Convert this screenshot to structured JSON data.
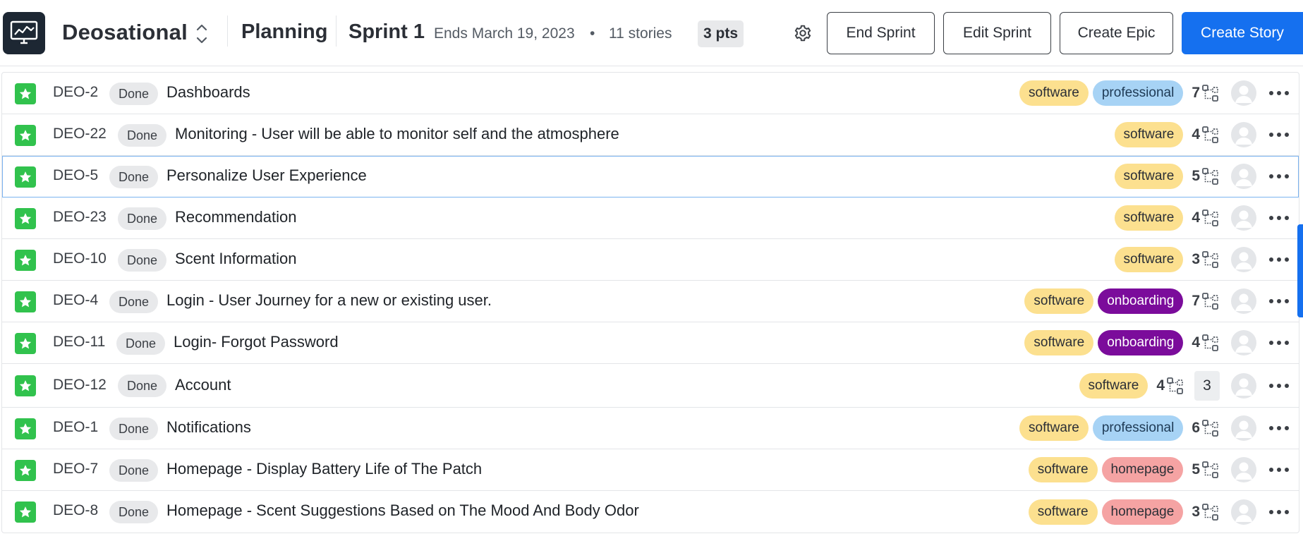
{
  "header": {
    "project_name": "Deosational",
    "page": "Planning",
    "sprint_name": "Sprint 1",
    "sprint_ends": "Ends March 19, 2023",
    "separator": "•",
    "stories_count": "11 stories",
    "points": "3 pts",
    "buttons": {
      "end_sprint": "End Sprint",
      "edit_sprint": "Edit Sprint",
      "create_epic": "Create Epic",
      "create_story": "Create Story"
    },
    "colors": {
      "primary": "#1570ef",
      "logo_bg": "#1d2733"
    },
    "icons": [
      "monitor-chart-icon",
      "chevron-up-down-icon",
      "gear-icon"
    ]
  },
  "stories": [
    {
      "key": "DEO-2",
      "status": "Done",
      "title": "Dashboards",
      "tags": [
        "software",
        "professional"
      ],
      "subtasks": "7",
      "comments": ""
    },
    {
      "key": "DEO-22",
      "status": "Done",
      "title": "Monitoring - User will be able to monitor self and the atmosphere",
      "tags": [
        "software"
      ],
      "subtasks": "4",
      "comments": ""
    },
    {
      "key": "DEO-5",
      "status": "Done",
      "title": "Personalize User Experience",
      "tags": [
        "software"
      ],
      "subtasks": "5",
      "comments": ""
    },
    {
      "key": "DEO-23",
      "status": "Done",
      "title": "Recommendation",
      "tags": [
        "software"
      ],
      "subtasks": "4",
      "comments": ""
    },
    {
      "key": "DEO-10",
      "status": "Done",
      "title": "Scent Information",
      "tags": [
        "software"
      ],
      "subtasks": "3",
      "comments": ""
    },
    {
      "key": "DEO-4",
      "status": "Done",
      "title": "Login - User Journey for a new or existing user.",
      "tags": [
        "software",
        "onboarding"
      ],
      "subtasks": "7",
      "comments": ""
    },
    {
      "key": "DEO-11",
      "status": "Done",
      "title": "Login- Forgot Password",
      "tags": [
        "software",
        "onboarding"
      ],
      "subtasks": "4",
      "comments": ""
    },
    {
      "key": "DEO-12",
      "status": "Done",
      "title": "Account",
      "tags": [
        "software"
      ],
      "subtasks": "4",
      "comments": "3"
    },
    {
      "key": "DEO-1",
      "status": "Done",
      "title": "Notifications",
      "tags": [
        "software",
        "professional"
      ],
      "subtasks": "6",
      "comments": ""
    },
    {
      "key": "DEO-7",
      "status": "Done",
      "title": "Homepage - Display Battery Life of The Patch",
      "tags": [
        "software",
        "homepage"
      ],
      "subtasks": "5",
      "comments": ""
    },
    {
      "key": "DEO-8",
      "status": "Done",
      "title": "Homepage - Scent Suggestions Based on The Mood And Body Odor",
      "tags": [
        "software",
        "homepage"
      ],
      "subtasks": "3",
      "comments": ""
    }
  ],
  "tag_colors": {
    "software": "#fce08f",
    "professional": "#a7d3f5",
    "onboarding": "#7b0c9b",
    "homepage": "#f5a3a3"
  },
  "row_icons": [
    "star-icon",
    "subtask-icon",
    "avatar-placeholder-icon",
    "more-options-icon"
  ]
}
